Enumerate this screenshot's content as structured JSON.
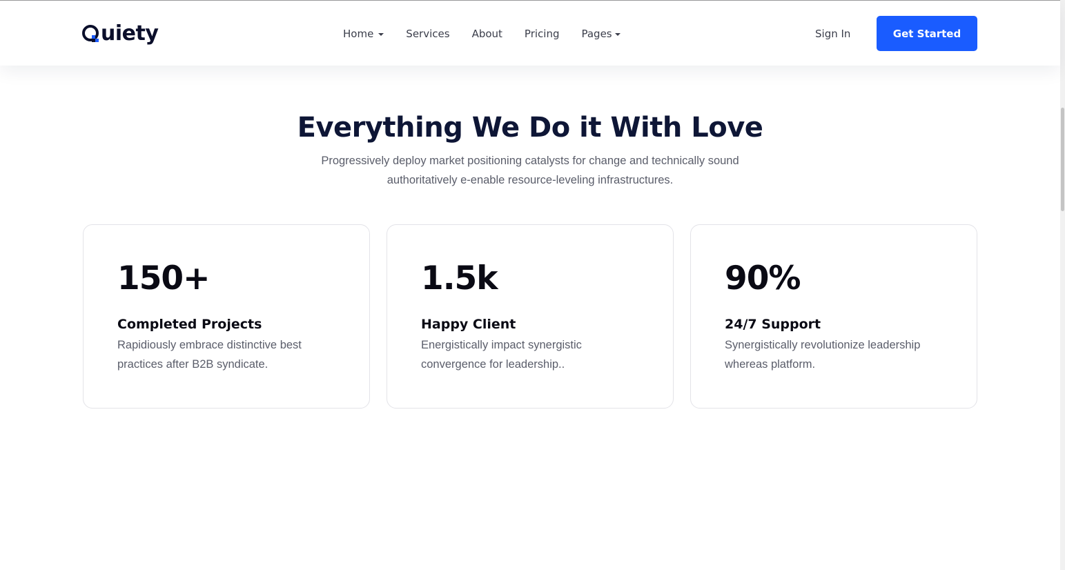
{
  "brand": {
    "logo_text": "uiety",
    "logo_letter_icon": "q-ring-pixel-mark",
    "colors": {
      "navy": "#0e1636",
      "accent": "#1a5cff",
      "text_muted": "#5a5d6a"
    }
  },
  "nav": {
    "items": [
      {
        "label": "Home",
        "has_dropdown": true
      },
      {
        "label": "Services",
        "has_dropdown": false
      },
      {
        "label": "About",
        "has_dropdown": false
      },
      {
        "label": "Pricing",
        "has_dropdown": false
      },
      {
        "label": "Pages",
        "has_dropdown": true
      }
    ],
    "sign_in": "Sign In",
    "cta": "Get Started"
  },
  "section": {
    "title": "Everything We Do it With Love",
    "subtitle_line1": "Progressively deploy market positioning catalysts for change and technically sound",
    "subtitle_line2": "authoritatively e-enable resource-leveling infrastructures."
  },
  "stats": [
    {
      "value": "150+",
      "label": "Completed Projects",
      "desc_line1": "Rapidiously embrace distinctive best",
      "desc_line2": "practices after B2B syndicate."
    },
    {
      "value": "1.5k",
      "label": "Happy Client",
      "desc_line1": "Energistically impact synergistic",
      "desc_line2": "convergence for leadership.."
    },
    {
      "value": "90%",
      "label": "24/7 Support",
      "desc_line1": "Synergistically revolutionize leadership",
      "desc_line2": "whereas platform."
    }
  ]
}
